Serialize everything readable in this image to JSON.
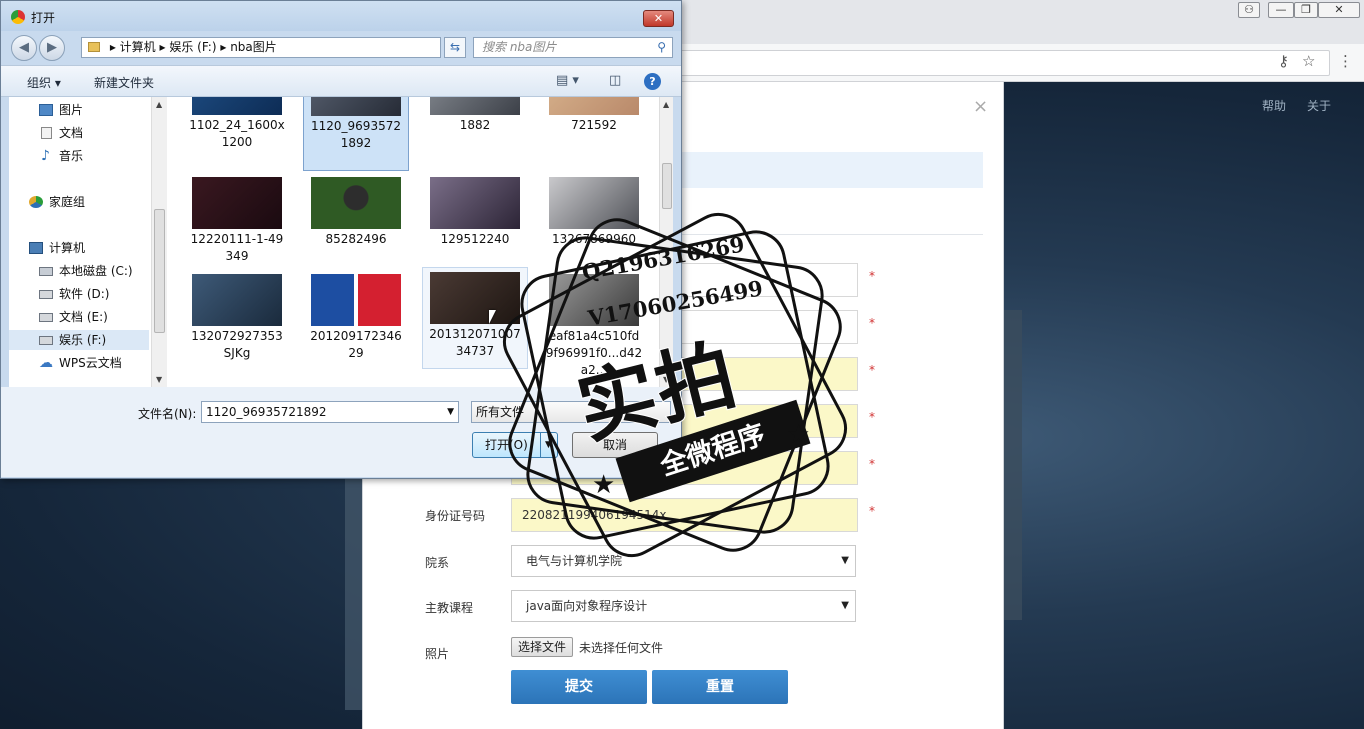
{
  "browser": {
    "nav_links": [
      "帮助",
      "关于"
    ]
  },
  "form": {
    "fields": [
      {
        "label": "",
        "value": "",
        "highlight": false
      },
      {
        "label": "",
        "value": "",
        "highlight": false
      },
      {
        "label": "",
        "value": "",
        "highlight": true
      },
      {
        "label": "",
        "value": "",
        "highlight": true
      },
      {
        "label": "",
        "value": "",
        "highlight": true
      },
      {
        "label": "身份证号码",
        "value": "220821199406194514x",
        "highlight": true
      }
    ],
    "required_mark": "*",
    "department": {
      "label": "院系",
      "value": "电气与计算机学院"
    },
    "course": {
      "label": "主教课程",
      "value": "java面向对象程序设计"
    },
    "photo": {
      "label": "照片",
      "button": "选择文件",
      "status": "未选择任何文件"
    },
    "submit": "提交",
    "reset": "重置"
  },
  "dialog": {
    "title": "打开",
    "close_glyph": "✕",
    "breadcrumb": [
      "计算机",
      "娱乐 (F:)",
      "nba图片"
    ],
    "search_placeholder": "搜索 nba图片",
    "commands": {
      "organize": "组织 ▾",
      "new_folder": "新建文件夹"
    },
    "sidebar": [
      {
        "label": "图片",
        "icon": "pictures-icon"
      },
      {
        "label": "文档",
        "icon": "documents-icon"
      },
      {
        "label": "音乐",
        "icon": "music-icon"
      },
      {
        "label": "家庭组",
        "icon": "homegroup-icon"
      },
      {
        "label": "计算机",
        "icon": "computer-icon"
      },
      {
        "label": "本地磁盘 (C:)",
        "icon": "drive-icon"
      },
      {
        "label": "软件 (D:)",
        "icon": "drive-icon"
      },
      {
        "label": "文档 (E:)",
        "icon": "drive-icon"
      },
      {
        "label": "娱乐 (F:)",
        "icon": "drive-icon"
      },
      {
        "label": "WPS云文档",
        "icon": "cloud-icon"
      }
    ],
    "selected_sidebar": "娱乐 (F:)",
    "files": [
      {
        "name": "1102_24_1600x1200"
      },
      {
        "name": "1120_96935721892",
        "selected": true
      },
      {
        "name": "1882"
      },
      {
        "name": "721592"
      },
      {
        "name": "12220111-1-49349"
      },
      {
        "name": "85282496"
      },
      {
        "name": "129512240"
      },
      {
        "name": "13267869960"
      },
      {
        "name": "132072927353SJKg"
      },
      {
        "name": "20120917234629"
      },
      {
        "name": "20131207100734737"
      },
      {
        "name": "eaf81a4c510fd9f96991f0...d42a2..."
      }
    ],
    "filename_label": "文件名(N):",
    "filename_value": "1120_96935721892",
    "filter": "所有文件",
    "open_button": "打开(O)",
    "cancel_button": "取消"
  },
  "watermark": {
    "qq": "Q2196316269",
    "wechat": "V17060256499",
    "main": "实拍",
    "ribbon": "全微程序"
  }
}
